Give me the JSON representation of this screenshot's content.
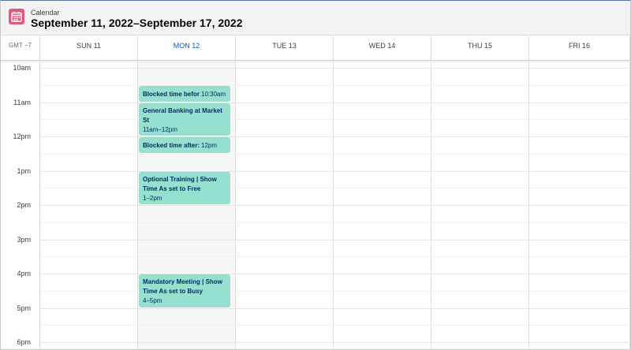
{
  "header": {
    "app_label": "Calendar",
    "title": "September 11, 2022–September 17, 2022",
    "icon": "calendar-icon",
    "icon_color": "#e3587f"
  },
  "timezone": "GMT −7",
  "days": [
    {
      "label": "SUN 11",
      "today": false
    },
    {
      "label": "MON 12",
      "today": true
    },
    {
      "label": "TUE 13",
      "today": false
    },
    {
      "label": "WED 14",
      "today": false
    },
    {
      "label": "THU 15",
      "today": false
    },
    {
      "label": "FRI 16",
      "today": false
    }
  ],
  "hours": [
    "10am",
    "11am",
    "12pm",
    "1pm",
    "2pm",
    "3pm",
    "4pm",
    "5pm",
    "6pm"
  ],
  "events": [
    {
      "title": "Blocked time before:",
      "time": "10:30am",
      "start": 10.5,
      "end": 11.0,
      "day": 1,
      "inline": true
    },
    {
      "title": "General Banking at Market St",
      "time": "11am–12pm",
      "start": 11.0,
      "end": 12.0,
      "day": 1,
      "inline": false
    },
    {
      "title": "Blocked time after: General Banking at Market St",
      "time": "12pm",
      "start": 12.0,
      "end": 12.5,
      "day": 1,
      "inline": true
    },
    {
      "title": "Optional Training | Show Time As set to Free",
      "time": "1–2pm",
      "start": 13.0,
      "end": 14.0,
      "day": 1,
      "inline": false
    },
    {
      "title": "Mandatory Meeting | Show Time As set to Busy",
      "time": "4–5pm",
      "start": 16.0,
      "end": 17.0,
      "day": 1,
      "inline": false
    }
  ],
  "colors": {
    "event_bg": "#96e0d0",
    "event_text": "#032d60",
    "today_header": "#0b5cab"
  }
}
